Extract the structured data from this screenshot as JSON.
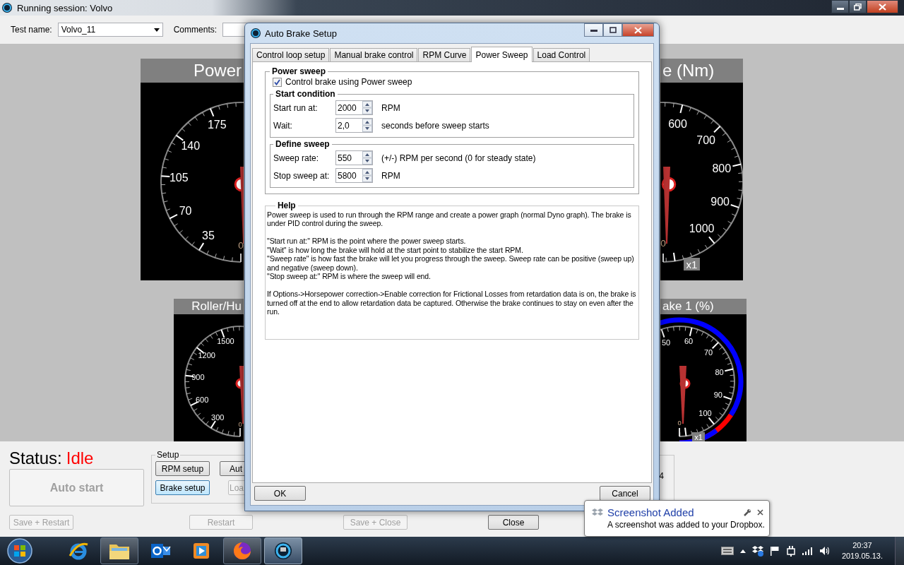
{
  "main_window": {
    "title": "Running session: Volvo",
    "test_name_label": "Test name:",
    "test_name": "Volvo_11",
    "comments_label": "Comments:",
    "gauges": [
      {
        "title": "Power",
        "kind": "plain",
        "ticks": [
          "175",
          "140",
          "105",
          "70",
          "35",
          "0"
        ]
      },
      {
        "title": "e (Nm)",
        "kind": "plain",
        "ticks": [
          "600",
          "700",
          "800",
          "900",
          "1000",
          "0"
        ],
        "badge": "x1"
      },
      {
        "title": "Roller/Hu",
        "kind": "plain",
        "ticks": [
          "1500",
          "1200",
          "900",
          "600",
          "300",
          "0"
        ]
      },
      {
        "title": "ake 1 (%)",
        "kind": "banded",
        "ticks": [
          "50",
          "60",
          "70",
          "80",
          "90",
          "100",
          "0"
        ],
        "badge": "x1"
      }
    ],
    "status_label": "Status:",
    "status_value": "Idle",
    "auto_start": {
      "label": "Auto start",
      "disabled": true
    },
    "setup": {
      "title": "Setup",
      "extra_text": "4",
      "buttons": [
        {
          "label": "RPM setup",
          "disabled": false,
          "focused": false
        },
        {
          "label": "Aut",
          "disabled": false,
          "focused": false
        },
        {
          "label": "Brake setup",
          "disabled": false,
          "focused": true
        },
        {
          "label": "Loa",
          "disabled": true,
          "focused": false
        }
      ]
    },
    "bottom_buttons": [
      {
        "label": "Save + Restart",
        "disabled": true
      },
      {
        "label": "Restart",
        "disabled": true
      },
      {
        "label": "Save + Close",
        "disabled": true
      },
      {
        "label": "Close",
        "disabled": false
      }
    ]
  },
  "dialog": {
    "title": "Auto Brake Setup",
    "tabs": [
      {
        "label": "Control loop setup",
        "selected": false
      },
      {
        "label": "Manual brake control",
        "selected": false
      },
      {
        "label": "RPM Curve",
        "selected": false
      },
      {
        "label": "Power Sweep",
        "selected": true
      },
      {
        "label": "Load Control",
        "selected": false
      }
    ],
    "power_sweep": {
      "title": "Power sweep",
      "checkbox": {
        "label": "Control brake using Power sweep",
        "checked": true
      },
      "groups": [
        {
          "title": "Start condition",
          "fields": [
            {
              "label": "Start run at:",
              "value": "2000",
              "unit": "RPM"
            },
            {
              "label": "Wait:",
              "value": "2,0",
              "unit": "seconds before sweep starts"
            }
          ]
        },
        {
          "title": "Define sweep",
          "fields": [
            {
              "label": "Sweep rate:",
              "value": "550",
              "unit": "(+/-) RPM per second (0 for steady state)"
            },
            {
              "label": "Stop sweep at:",
              "value": "5800",
              "unit": "RPM"
            }
          ]
        }
      ]
    },
    "help": {
      "title": "Help",
      "paragraphs": [
        [
          "Power sweep is used to run through the RPM range and create a power graph (normal Dyno graph). The brake is under PID control during the sweep."
        ],
        [
          "\"Start run at:\" RPM is the point where the power sweep starts.",
          "\"Wait\" is how long the brake will hold at the start point to stabilize the start RPM.",
          "\"Sweep rate\" is how fast the brake will let you progress through the sweep. Sweep rate can be positive (sweep up) and negative (sweep down).",
          "\"Stop sweep at:\" RPM is where the sweep will end."
        ],
        [
          "If Options->Horsepower correction->Enable correction for Frictional Losses from retardation data is on, the brake is turned off at the end to allow retardation data be captured. Otherwise the brake continues to stay on even after the run."
        ]
      ]
    },
    "buttons": [
      {
        "label": "OK"
      },
      {
        "label": "Cancel"
      }
    ]
  },
  "notification": {
    "title": "Screenshot Added",
    "message": "A screenshot was added to your Dropbox."
  },
  "taskbar": {
    "apps": [
      {
        "running": false,
        "selected": false
      },
      {
        "running": true,
        "selected": false
      },
      {
        "running": false,
        "selected": false
      },
      {
        "running": false,
        "selected": false
      },
      {
        "running": true,
        "selected": false
      },
      {
        "running": true,
        "selected": true
      }
    ],
    "time": "20:37",
    "date": "2019.05.13."
  }
}
